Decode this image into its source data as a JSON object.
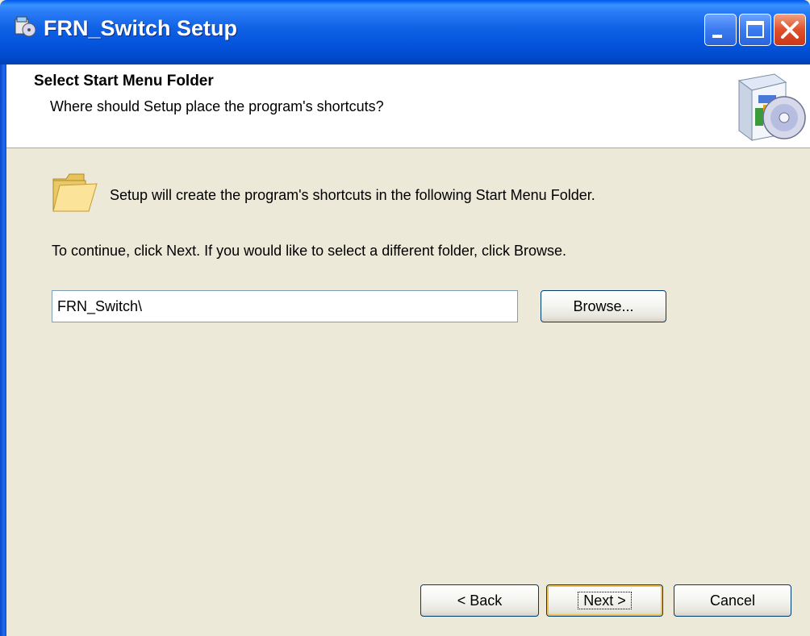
{
  "window": {
    "title": "FRN_Switch Setup"
  },
  "header": {
    "title": "Select Start Menu Folder",
    "subtitle": "Where should Setup place the program's shortcuts?"
  },
  "body": {
    "info_text": "Setup will create the program's shortcuts in the following Start Menu Folder.",
    "instruction_text": "To continue, click Next. If you would like to select a different folder, click Browse."
  },
  "folder_input": {
    "value": "FRN_Switch\\"
  },
  "buttons": {
    "browse": "Browse...",
    "back": "< Back",
    "next": "Next >",
    "cancel": "Cancel"
  },
  "icons": {
    "app": "setup-app-icon",
    "header": "setup-box-cd-icon",
    "folder": "folder-icon"
  }
}
